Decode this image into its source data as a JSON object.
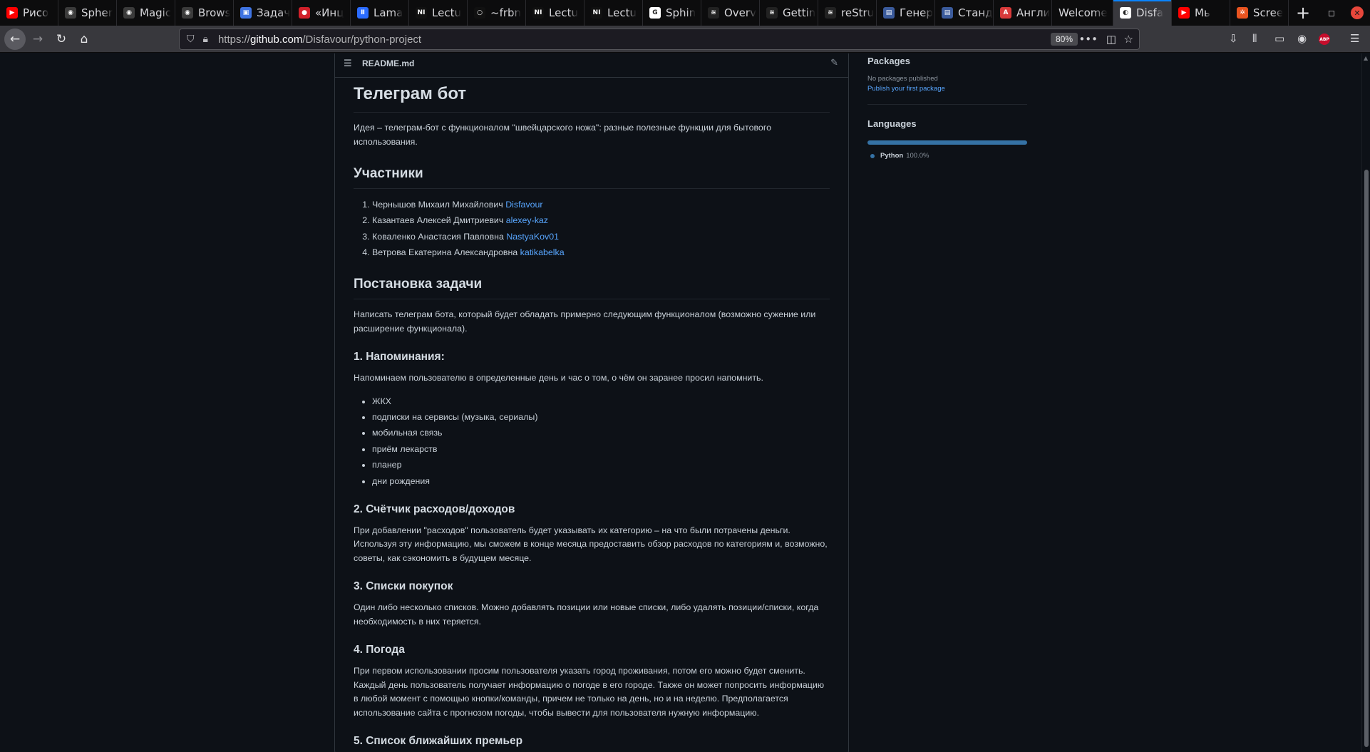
{
  "tabs": [
    {
      "label": "Рисо",
      "icon": "youtube-icon",
      "color": "#ff0000"
    },
    {
      "label": "Spher",
      "icon": "app-icon",
      "color": "#3b3b3b"
    },
    {
      "label": "Magic",
      "icon": "app-icon",
      "color": "#3b3b3b"
    },
    {
      "label": "Brows",
      "icon": "app-icon",
      "color": "#3b3b3b"
    },
    {
      "label": "Задач",
      "icon": "classroom-icon",
      "color": "#3f74e3"
    },
    {
      "label": "«Инц",
      "icon": "red-circle-icon",
      "color": "#d1202a"
    },
    {
      "label": "Lama",
      "icon": "lamp-icon",
      "color": "#2b6cff"
    },
    {
      "label": "Lectu",
      "icon": "ni-icon",
      "color": "#111111"
    },
    {
      "label": "~frbn",
      "icon": "circle-icon",
      "color": "#111111"
    },
    {
      "label": "Lectu",
      "icon": "ni-icon",
      "color": "#111111"
    },
    {
      "label": "Lectu",
      "icon": "ni-icon",
      "color": "#111111"
    },
    {
      "label": "Sphin",
      "icon": "google-icon",
      "color": "#ffffff"
    },
    {
      "label": "Overv",
      "icon": "sphinx-icon",
      "color": "#222222"
    },
    {
      "label": "Gettin",
      "icon": "sphinx-icon",
      "color": "#222222"
    },
    {
      "label": "reStru",
      "icon": "sphinx-icon",
      "color": "#222222"
    },
    {
      "label": "Генер",
      "icon": "doc-icon",
      "color": "#3b5b9c"
    },
    {
      "label": "Станд",
      "icon": "doc-icon",
      "color": "#3b5b9c"
    },
    {
      "label": "Англи",
      "icon": "translate-icon",
      "color": "#d83a3a"
    },
    {
      "label": "Welcome",
      "icon": "",
      "color": "#000000"
    },
    {
      "label": "Disfa",
      "icon": "github-icon",
      "color": "#ffffff"
    },
    {
      "label": "Mь",
      "icon": "youtube-icon",
      "color": "#ff0000"
    },
    {
      "label": "Scree",
      "icon": "ubuntu-icon",
      "color": "#e95420"
    }
  ],
  "nav": {
    "url_prefix": "https://",
    "url_host": "github.com",
    "url_path": "/Disfavour/python-project",
    "zoom": "80%",
    "abp_label": "ABP"
  },
  "readme": {
    "filename": "README.md",
    "title": "Телеграм бот",
    "intro": "Идея – телеграм-бот с функционалом \"швейцарского ножа\": разные полезные функции для бытового использования.",
    "members_heading": "Участники",
    "members": [
      {
        "name": "Чернышов Михаил Михайлович",
        "handle": "Disfavour"
      },
      {
        "name": "Казантаев Алексей Дмитриевич",
        "handle": "alexey-kaz"
      },
      {
        "name": "Коваленко Анастасия Павловна",
        "handle": "NastyaKov01"
      },
      {
        "name": "Ветрова Екатерина Александровна",
        "handle": "katikabelka"
      }
    ],
    "task_heading": "Постановка задачи",
    "task_text": "Написать телеграм бота, который будет обладать примерно следующим функционалом (возможно сужение или расширение функционала).",
    "s1_heading": "1. Напоминания:",
    "s1_text": "Напоминаем пользователю в определенные день и час о том, о чём он заранее просил напомнить.",
    "s1_items": [
      "ЖКХ",
      "подписки на сервисы (музыка, сериалы)",
      "мобильная связь",
      "приём лекарств",
      "планер",
      "дни рождения"
    ],
    "s2_heading": "2. Счётчик расходов/доходов",
    "s2_text": "При добавлении \"расходов\" пользователь будет указывать их категорию – на что были потрачены деньги. Используя эту информацию, мы сможем в конце месяца предоставить обзор расходов по категориям и, возможно, советы, как сэкономить в будущем месяце.",
    "s3_heading": "3. Списки покупок",
    "s3_text": "Один либо несколько списков. Можно добавлять позиции или новые списки, либо удалять позиции/списки, когда необходимость в них теряется.",
    "s4_heading": "4. Погода",
    "s4_text": "При первом использовании просим пользователя указать город проживания, потом его можно будет сменить. Каждый день пользователь получает информацию о погоде в его городе. Также он может попросить информацию в любой момент с помощью кнопки/команды, причем не только на день, но и на неделю. Предполагается использование сайта с прогнозом погоды, чтобы вывести для пользователя нужную информацию.",
    "s5_heading": "5. Список ближайших премьер"
  },
  "sidebar": {
    "packages_title": "Packages",
    "packages_none": "No packages published",
    "packages_link": "Publish your first package",
    "languages_title": "Languages",
    "language_name": "Python",
    "language_pct": "100.0%",
    "language_color": "#3572A5"
  }
}
